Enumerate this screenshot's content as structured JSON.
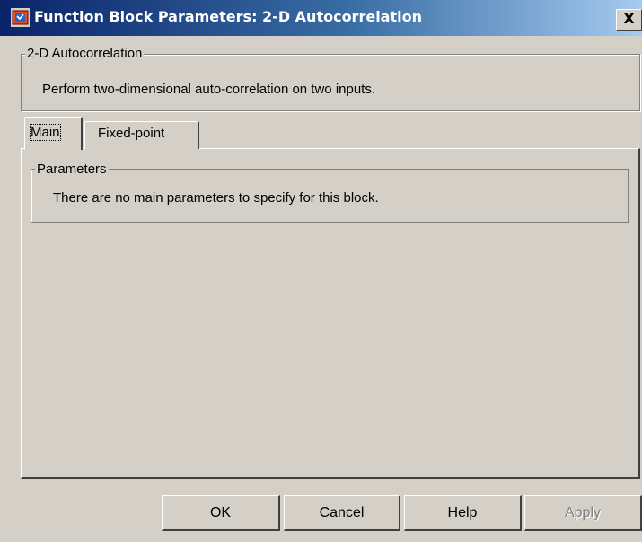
{
  "window": {
    "title": "Function Block Parameters: 2-D Autocorrelation",
    "close_glyph": "X"
  },
  "block": {
    "group_label": "2-D Autocorrelation",
    "description": "Perform two-dimensional auto-correlation on two inputs."
  },
  "tabs": [
    {
      "label": "Main",
      "selected": true
    },
    {
      "label": "Fixed-point",
      "selected": false
    }
  ],
  "parameters": {
    "group_label": "Parameters",
    "message": "There are no main parameters to specify for this block."
  },
  "buttons": {
    "ok": "OK",
    "cancel": "Cancel",
    "help": "Help",
    "apply": "Apply"
  },
  "colors": {
    "face": "#d4d0c8",
    "title_start": "#0a246a",
    "title_end": "#a6caf0",
    "disabled_text": "#808080"
  }
}
